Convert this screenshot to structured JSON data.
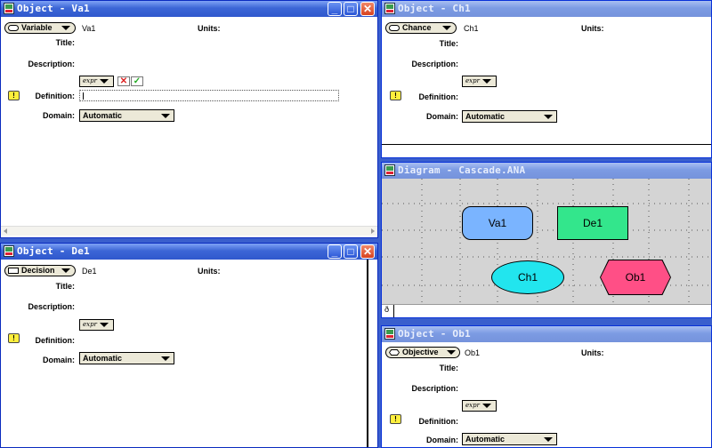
{
  "windows": {
    "va1": {
      "title": "Object - Va1",
      "class_label": "Variable",
      "identifier": "Va1",
      "units_label": "Units:",
      "title_label": "Title:",
      "description_label": "Description:",
      "expr_label": "expr",
      "definition_label": "Definition:",
      "warn_glyph": "!",
      "cancel_glyph": "✕",
      "ok_glyph": "✓",
      "domain_label": "Domain:",
      "domain_value": "Automatic"
    },
    "ch1": {
      "title": "Object - Ch1",
      "class_label": "Chance",
      "identifier": "Ch1",
      "units_label": "Units:",
      "title_label": "Title:",
      "description_label": "Description:",
      "expr_label": "expr",
      "definition_label": "Definition:",
      "warn_glyph": "!",
      "domain_label": "Domain:",
      "domain_value": "Automatic"
    },
    "diagram": {
      "title": "Diagram - Cascade.ANA",
      "status_glyph": "ð",
      "nodes": {
        "va1": "Va1",
        "de1": "De1",
        "ch1": "Ch1",
        "ob1": "Ob1"
      }
    },
    "de1": {
      "title": "Object - De1",
      "class_label": "Decision",
      "identifier": "De1",
      "units_label": "Units:",
      "title_label": "Title:",
      "description_label": "Description:",
      "expr_label": "expr",
      "definition_label": "Definition:",
      "warn_glyph": "!",
      "domain_label": "Domain:",
      "domain_value": "Automatic"
    },
    "ob1": {
      "title": "Object - Ob1",
      "class_label": "Objective",
      "identifier": "Ob1",
      "units_label": "Units:",
      "title_label": "Title:",
      "description_label": "Description:",
      "expr_label": "expr",
      "definition_label": "Definition:",
      "warn_glyph": "!",
      "domain_label": "Domain:",
      "domain_value": "Automatic"
    }
  },
  "title_buttons": {
    "minimize": "_",
    "maximize": "□",
    "close": "✕"
  },
  "colors": {
    "variable_node": "#7ab4ff",
    "decision_node": "#33e68c",
    "chance_node": "#22e5ee",
    "objective_node": "#ff4f86",
    "titlebar_active": "#2f58cd",
    "warning": "#ffef3d"
  },
  "icons": {
    "window": "analytica-window-icon",
    "warning": "warning-icon",
    "dropdown": "dropdown-arrow-icon"
  }
}
